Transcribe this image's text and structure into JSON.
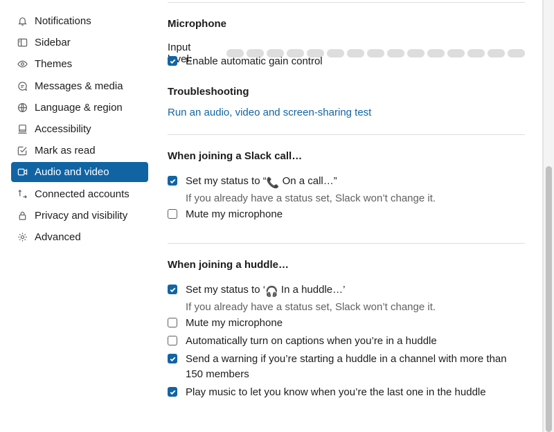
{
  "sidebar": {
    "items": [
      {
        "label": "Notifications",
        "icon": "bell-icon"
      },
      {
        "label": "Sidebar",
        "icon": "sidebar-icon"
      },
      {
        "label": "Themes",
        "icon": "eye-icon"
      },
      {
        "label": "Messages & media",
        "icon": "message-icon"
      },
      {
        "label": "Language & region",
        "icon": "globe-icon"
      },
      {
        "label": "Accessibility",
        "icon": "monitor-icon"
      },
      {
        "label": "Mark as read",
        "icon": "check-square-icon"
      },
      {
        "label": "Audio and video",
        "icon": "video-icon",
        "active": true
      },
      {
        "label": "Connected accounts",
        "icon": "arrows-icon"
      },
      {
        "label": "Privacy and visibility",
        "icon": "lock-icon"
      },
      {
        "label": "Advanced",
        "icon": "gear-icon"
      }
    ]
  },
  "microphone": {
    "title": "Microphone",
    "input_level_label": "Input level:",
    "input_level_value": 0,
    "gain_control_label": "Enable automatic gain control",
    "gain_control_checked": true
  },
  "troubleshooting": {
    "title": "Troubleshooting",
    "test_link": "Run an audio, video and screen-sharing test"
  },
  "slack_call": {
    "title": "When joining a Slack call…",
    "status_prefix": "Set my status to “",
    "status_text": " On a call…”",
    "status_emoji": "📞",
    "status_checked": true,
    "status_hint": "If you already have a status set, Slack won’t change it.",
    "mute_label": "Mute my microphone",
    "mute_checked": false
  },
  "huddle": {
    "title": "When joining a huddle…",
    "status_prefix": "Set my status to ‘",
    "status_text": " In a huddle…’",
    "status_emoji": "🎧",
    "status_checked": true,
    "status_hint": "If you already have a status set, Slack won’t change it.",
    "mute_label": "Mute my microphone",
    "mute_checked": false,
    "captions_label": "Automatically turn on captions when you’re in a huddle",
    "captions_checked": false,
    "warning_label": "Send a warning if you’re starting a huddle in a channel with more than 150 members",
    "warning_checked": true,
    "music_label": "Play music to let you know when you’re the last one in the huddle",
    "music_checked": true
  },
  "colors": {
    "accent": "#1264a3",
    "active_nav": "#1164a3",
    "text": "#1d1c1d",
    "muted": "#616061"
  }
}
